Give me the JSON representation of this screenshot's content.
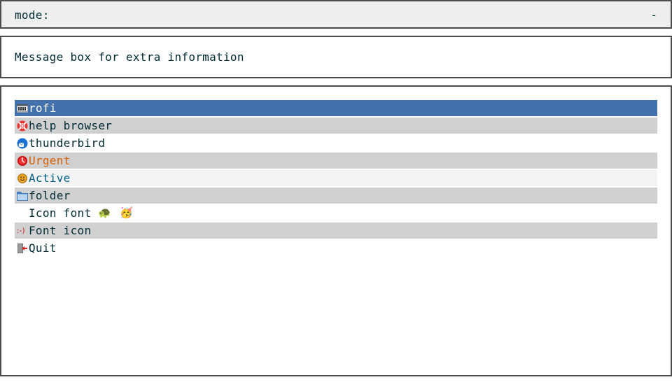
{
  "prompt": {
    "label": "mode:",
    "case_indicator": "-"
  },
  "message": {
    "text": "Message box for extra information"
  },
  "entries": [
    {
      "label": "rofi",
      "icon": "rofi-icon",
      "state": "selected"
    },
    {
      "label": "help browser",
      "icon": "help-browser-icon",
      "state": "normal"
    },
    {
      "label": "thunderbird",
      "icon": "thunderbird-icon",
      "state": "normal"
    },
    {
      "label": "Urgent",
      "icon": "clock-icon",
      "state": "urgent"
    },
    {
      "label": "Active",
      "icon": "smiley-icon",
      "state": "active"
    },
    {
      "label": "folder",
      "icon": "folder-icon",
      "state": "normal"
    },
    {
      "label": "Icon font",
      "icon": "none",
      "state": "normal",
      "emoji": [
        "🐢",
        "🥳"
      ]
    },
    {
      "label": "Font icon",
      "icon": "font-smiley-icon",
      "icon_text": ":-)",
      "state": "normal"
    },
    {
      "label": "Quit",
      "icon": "exit-icon",
      "state": "normal"
    }
  ],
  "colors": {
    "selected_bg": "#4271ae",
    "alt_bg": "#d0d0d0",
    "urgent_fg": "#d75f00",
    "active_fg": "#005f87",
    "text": "#002b36",
    "border": "#4b4b4b"
  }
}
